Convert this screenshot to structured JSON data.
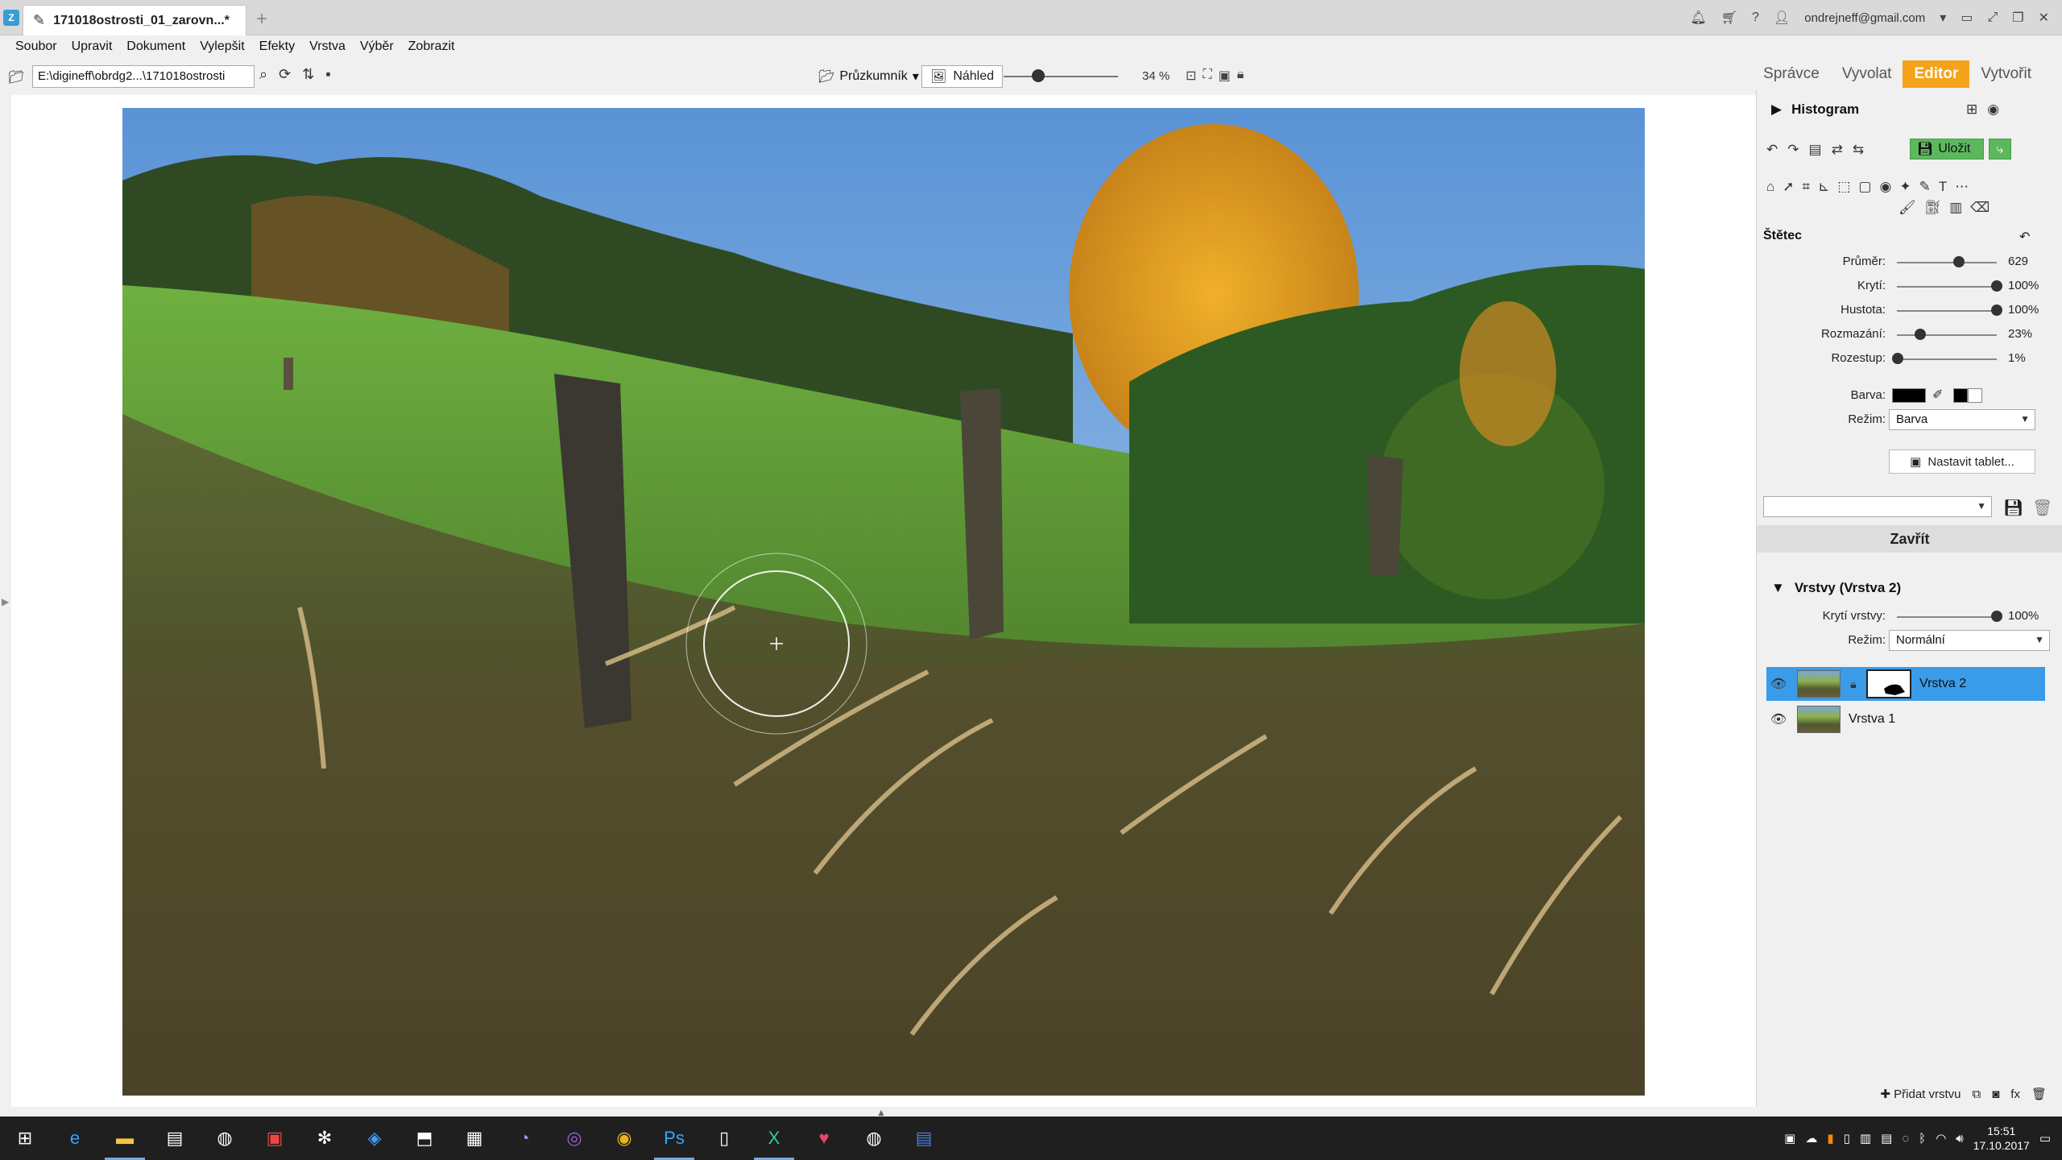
{
  "titlebar": {
    "tab_title": "171018ostrosti_01_zarovn...*",
    "account": "ondrejneff@gmail.com"
  },
  "menu": [
    "Soubor",
    "Upravit",
    "Dokument",
    "Vylepšit",
    "Efekty",
    "Vrstva",
    "Výběr",
    "Zobrazit"
  ],
  "toolbar": {
    "path": "E:\\digineff\\obrdg2...\\171018ostrosti",
    "browser_label": "Průzkumník",
    "preview_label": "Náhled",
    "zoom": "34 %"
  },
  "modes": [
    {
      "label": "Správce",
      "active": false
    },
    {
      "label": "Vyvolat",
      "active": false
    },
    {
      "label": "Editor",
      "active": true
    },
    {
      "label": "Vytvořit",
      "active": false
    }
  ],
  "panel": {
    "histogram_title": "Histogram",
    "save_label": "Uložit",
    "brush_title": "Štětec",
    "sliders": [
      {
        "label": "Průměr:",
        "value": "629",
        "fraction": 0.62
      },
      {
        "label": "Krytí:",
        "value": "100%",
        "fraction": 1.0
      },
      {
        "label": "Hustota:",
        "value": "100%",
        "fraction": 1.0
      },
      {
        "label": "Rozmazání:",
        "value": "23%",
        "fraction": 0.23
      },
      {
        "label": "Rozestup:",
        "value": "1%",
        "fraction": 0.01
      }
    ],
    "color_label": "Barva:",
    "mode_label": "Režim:",
    "mode_value": "Barva",
    "tablet_button": "Nastavit tablet...",
    "close_button": "Zavřít",
    "layers_title": "Vrstvy (Vrstva 2)",
    "layer_opacity_label": "Krytí vrstvy:",
    "layer_opacity_value": "100%",
    "layer_opacity_fraction": 1.0,
    "layer_mode_label": "Režim:",
    "layer_mode_value": "Normální",
    "layers": [
      {
        "name": "Vrstva 2",
        "selected": true
      },
      {
        "name": "Vrstva 1",
        "selected": false
      }
    ],
    "add_layer": "Přidat vrstvu"
  },
  "taskbar": {
    "time": "15:51",
    "date": "17.10.2017"
  }
}
